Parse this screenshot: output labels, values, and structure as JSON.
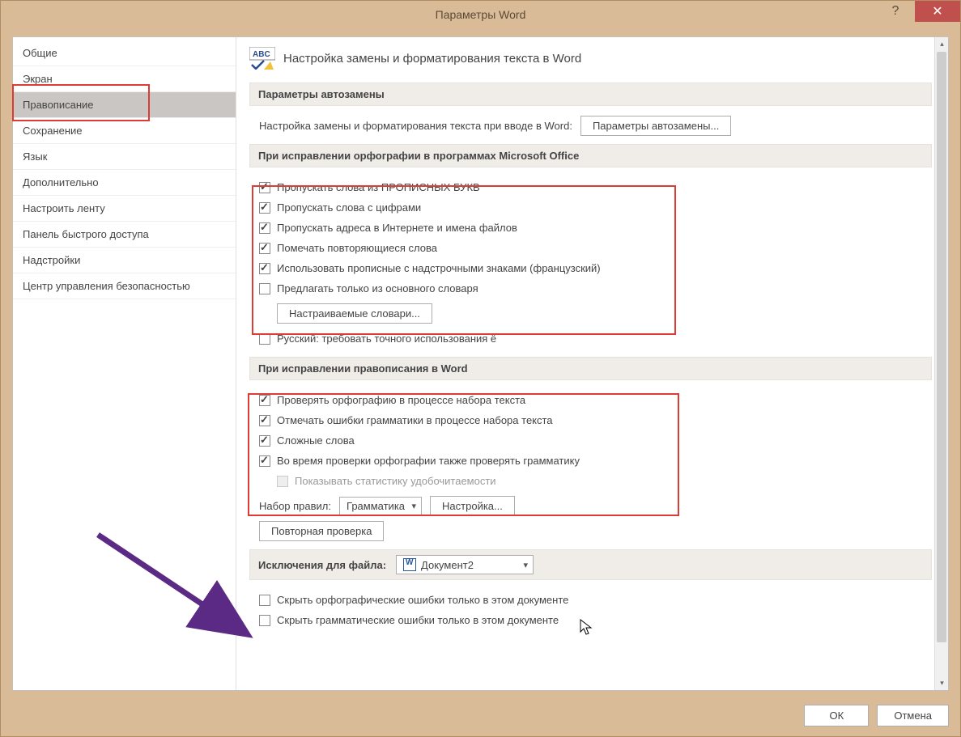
{
  "titlebar": {
    "title": "Параметры Word"
  },
  "sidebar": {
    "items": [
      "Общие",
      "Экран",
      "Правописание",
      "Сохранение",
      "Язык",
      "Дополнительно",
      "Настроить ленту",
      "Панель быстрого доступа",
      "Надстройки",
      "Центр управления безопасностью"
    ],
    "selected_index": 2
  },
  "header_line": "Настройка замены и форматирования текста в Word",
  "group_autocorrect": {
    "title": "Параметры автозамены",
    "line": "Настройка замены и форматирования текста при вводе в Word:",
    "button": "Параметры автозамены..."
  },
  "group_spelling_office": {
    "title": "При исправлении орфографии в программах Microsoft Office",
    "checks": [
      {
        "label": "Пропускать слова из ПРОПИСНЫХ БУКВ",
        "checked": true
      },
      {
        "label": "Пропускать слова с цифрами",
        "checked": true
      },
      {
        "label": "Пропускать адреса в Интернете и имена файлов",
        "checked": true
      },
      {
        "label": "Помечать повторяющиеся слова",
        "checked": true
      },
      {
        "label": "Использовать прописные с надстрочными знаками (французский)",
        "checked": true
      },
      {
        "label": "Предлагать только из основного словаря",
        "checked": false
      }
    ],
    "dict_button": "Настраиваемые словари...",
    "russian_yo": {
      "label": "Русский: требовать точного использования ё",
      "checked": false
    }
  },
  "group_spelling_word": {
    "title": "При исправлении правописания в Word",
    "checks": [
      {
        "label": "Проверять орфографию в процессе набора текста",
        "checked": true
      },
      {
        "label": "Отмечать ошибки грамматики в процессе набора текста",
        "checked": true
      },
      {
        "label": "Сложные слова",
        "checked": true
      },
      {
        "label": "Во время проверки орфографии также проверять грамматику",
        "checked": true
      }
    ],
    "readability": {
      "label": "Показывать статистику удобочитаемости",
      "checked": false,
      "disabled": true
    },
    "ruleset_label": "Набор правил:",
    "ruleset_value": "Грамматика",
    "settings_button": "Настройка...",
    "recheck_button": "Повторная проверка"
  },
  "group_exceptions": {
    "title": "Исключения для файла:",
    "file_value": "Документ2",
    "checks": [
      {
        "label": "Скрыть орфографические ошибки только в этом документе",
        "checked": false
      },
      {
        "label": "Скрыть грамматические ошибки только в этом документе",
        "checked": false
      }
    ]
  },
  "footer": {
    "ok": "ОК",
    "cancel": "Отмена"
  }
}
